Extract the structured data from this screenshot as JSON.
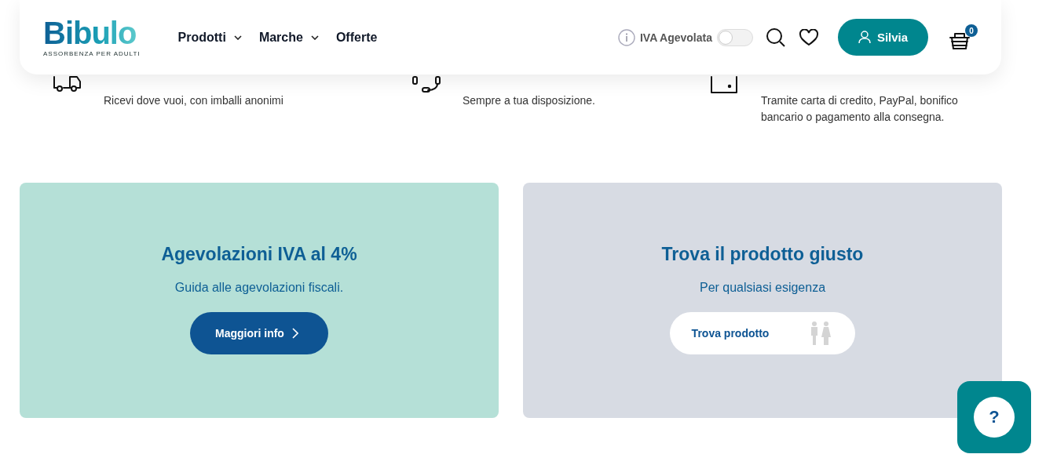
{
  "header": {
    "logo": {
      "name": "Bibulo",
      "tagline": "ASSORBENZA PER ADULTI"
    },
    "nav": [
      {
        "label": "Prodotti",
        "has_menu": true
      },
      {
        "label": "Marche",
        "has_menu": true
      },
      {
        "label": "Offerte",
        "has_menu": false
      }
    ],
    "vat_toggle": {
      "label": "IVA Agevolata",
      "on": false
    },
    "account_button": "Silvia",
    "cart_count": "0"
  },
  "features": [
    {
      "kind": "truck",
      "text": "Ricevi dove vuoi, con imballi anonimi"
    },
    {
      "kind": "headset",
      "text": "Sempre a tua disposizione."
    },
    {
      "kind": "card",
      "text": "Tramite carta di credito, PayPal, bonifico bancario o pagamento alla consegna."
    }
  ],
  "promos": [
    {
      "kind": "dark",
      "title": "Agevolazioni IVA al 4%",
      "text": "Guida alle agevolazioni fiscali.",
      "button": "Maggiori info"
    },
    {
      "kind": "light",
      "title": "Trova il prodotto giusto",
      "text": "Per qualsiasi esigenza",
      "button": "Trova prodotto"
    }
  ],
  "help_button": "?"
}
